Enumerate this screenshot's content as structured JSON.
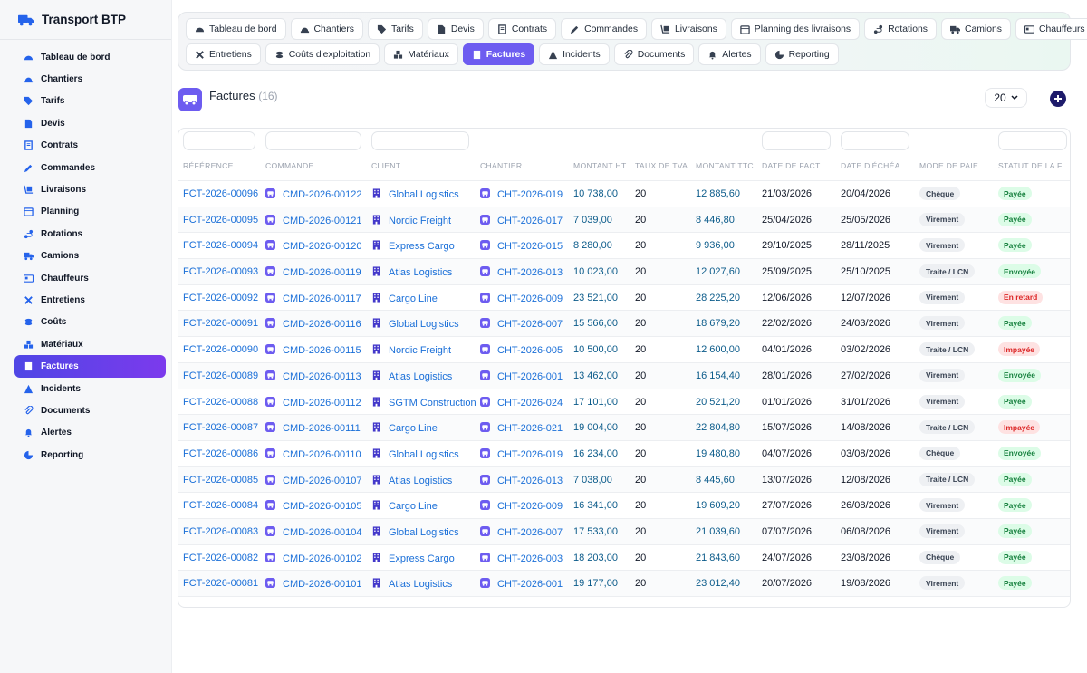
{
  "app": {
    "title": "Transport BTP"
  },
  "sidebar": {
    "items": [
      {
        "label": "Tableau de bord",
        "icon": "gauge-icon"
      },
      {
        "label": "Chantiers",
        "icon": "hardhat-icon"
      },
      {
        "label": "Tarifs",
        "icon": "tag-icon"
      },
      {
        "label": "Devis",
        "icon": "file-icon"
      },
      {
        "label": "Contrats",
        "icon": "contract-icon"
      },
      {
        "label": "Commandes",
        "icon": "edit-icon"
      },
      {
        "label": "Livraisons",
        "icon": "dolly-icon"
      },
      {
        "label": "Planning",
        "icon": "calendar-icon"
      },
      {
        "label": "Rotations",
        "icon": "route-icon"
      },
      {
        "label": "Camions",
        "icon": "truck-icon"
      },
      {
        "label": "Chauffeurs",
        "icon": "id-card-icon"
      },
      {
        "label": "Entretiens",
        "icon": "tools-icon"
      },
      {
        "label": "Coûts",
        "icon": "coins-icon"
      },
      {
        "label": "Matériaux",
        "icon": "cubes-icon"
      },
      {
        "label": "Factures",
        "icon": "invoice-icon",
        "active": true
      },
      {
        "label": "Incidents",
        "icon": "warning-icon"
      },
      {
        "label": "Documents",
        "icon": "paperclip-icon"
      },
      {
        "label": "Alertes",
        "icon": "bell-icon"
      },
      {
        "label": "Reporting",
        "icon": "pie-chart-icon"
      }
    ]
  },
  "tabs": {
    "row1": [
      {
        "label": "Tableau de bord",
        "icon": "gauge-icon"
      },
      {
        "label": "Chantiers",
        "icon": "hardhat-icon"
      },
      {
        "label": "Tarifs",
        "icon": "tag-icon"
      },
      {
        "label": "Devis",
        "icon": "file-icon"
      },
      {
        "label": "Contrats",
        "icon": "contract-icon"
      },
      {
        "label": "Commandes",
        "icon": "edit-icon"
      },
      {
        "label": "Livraisons",
        "icon": "dolly-icon"
      },
      {
        "label": "Planning des livraisons",
        "icon": "calendar-icon"
      },
      {
        "label": "Rotations",
        "icon": "route-icon"
      },
      {
        "label": "Camions",
        "icon": "truck-icon"
      },
      {
        "label": "Chauffeurs",
        "icon": "id-card-icon"
      }
    ],
    "row2": [
      {
        "label": "Entretiens",
        "icon": "tools-icon"
      },
      {
        "label": "Coûts d'exploitation",
        "icon": "coins-icon"
      },
      {
        "label": "Matériaux",
        "icon": "cubes-icon"
      },
      {
        "label": "Factures",
        "icon": "invoice-icon",
        "active": true
      },
      {
        "label": "Incidents",
        "icon": "warning-icon"
      },
      {
        "label": "Documents",
        "icon": "paperclip-icon"
      },
      {
        "label": "Alertes",
        "icon": "bell-icon"
      },
      {
        "label": "Reporting",
        "icon": "pie-chart-icon"
      }
    ]
  },
  "header": {
    "title": "Factures",
    "count": "(16)",
    "page_size": "20"
  },
  "table": {
    "columns": [
      "RÉFÉRENCE",
      "COMMANDE",
      "CLIENT",
      "CHANTIER",
      "MONTANT HT",
      "TAUX DE TVA",
      "MONTANT TTC",
      "DATE DE FACT...",
      "DATE D'ÉCHÉA...",
      "MODE DE PAIE...",
      "STATUT DE LA F..."
    ],
    "rows": [
      {
        "ref": "FCT-2026-00096",
        "cmd": "CMD-2026-00122",
        "client": "Global Logistics",
        "chantier": "CHT-2026-019",
        "ht": "10 738,00",
        "tva": "20",
        "ttc": "12 885,60",
        "date_fact": "21/03/2026",
        "date_ech": "20/04/2026",
        "mode": "Chèque",
        "statut": "Payée"
      },
      {
        "ref": "FCT-2026-00095",
        "cmd": "CMD-2026-00121",
        "client": "Nordic Freight",
        "chantier": "CHT-2026-017",
        "ht": "7 039,00",
        "tva": "20",
        "ttc": "8 446,80",
        "date_fact": "25/04/2026",
        "date_ech": "25/05/2026",
        "mode": "Virement",
        "statut": "Payée"
      },
      {
        "ref": "FCT-2026-00094",
        "cmd": "CMD-2026-00120",
        "client": "Express Cargo",
        "chantier": "CHT-2026-015",
        "ht": "8 280,00",
        "tva": "20",
        "ttc": "9 936,00",
        "date_fact": "29/10/2025",
        "date_ech": "28/11/2025",
        "mode": "Virement",
        "statut": "Payée"
      },
      {
        "ref": "FCT-2026-00093",
        "cmd": "CMD-2026-00119",
        "client": "Atlas Logistics",
        "chantier": "CHT-2026-013",
        "ht": "10 023,00",
        "tva": "20",
        "ttc": "12 027,60",
        "date_fact": "25/09/2025",
        "date_ech": "25/10/2025",
        "mode": "Traite / LCN",
        "statut": "Envoyée"
      },
      {
        "ref": "FCT-2026-00092",
        "cmd": "CMD-2026-00117",
        "client": "Cargo Line",
        "chantier": "CHT-2026-009",
        "ht": "23 521,00",
        "tva": "20",
        "ttc": "28 225,20",
        "date_fact": "12/06/2026",
        "date_ech": "12/07/2026",
        "mode": "Virement",
        "statut": "En retard"
      },
      {
        "ref": "FCT-2026-00091",
        "cmd": "CMD-2026-00116",
        "client": "Global Logistics",
        "chantier": "CHT-2026-007",
        "ht": "15 566,00",
        "tva": "20",
        "ttc": "18 679,20",
        "date_fact": "22/02/2026",
        "date_ech": "24/03/2026",
        "mode": "Virement",
        "statut": "Payée"
      },
      {
        "ref": "FCT-2026-00090",
        "cmd": "CMD-2026-00115",
        "client": "Nordic Freight",
        "chantier": "CHT-2026-005",
        "ht": "10 500,00",
        "tva": "20",
        "ttc": "12 600,00",
        "date_fact": "04/01/2026",
        "date_ech": "03/02/2026",
        "mode": "Traite / LCN",
        "statut": "Impayée"
      },
      {
        "ref": "FCT-2026-00089",
        "cmd": "CMD-2026-00113",
        "client": "Atlas Logistics",
        "chantier": "CHT-2026-001",
        "ht": "13 462,00",
        "tva": "20",
        "ttc": "16 154,40",
        "date_fact": "28/01/2026",
        "date_ech": "27/02/2026",
        "mode": "Virement",
        "statut": "Envoyée"
      },
      {
        "ref": "FCT-2026-00088",
        "cmd": "CMD-2026-00112",
        "client": "SGTM Construction",
        "chantier": "CHT-2026-024",
        "ht": "17 101,00",
        "tva": "20",
        "ttc": "20 521,20",
        "date_fact": "01/01/2026",
        "date_ech": "31/01/2026",
        "mode": "Virement",
        "statut": "Payée"
      },
      {
        "ref": "FCT-2026-00087",
        "cmd": "CMD-2026-00111",
        "client": "Cargo Line",
        "chantier": "CHT-2026-021",
        "ht": "19 004,00",
        "tva": "20",
        "ttc": "22 804,80",
        "date_fact": "15/07/2026",
        "date_ech": "14/08/2026",
        "mode": "Traite / LCN",
        "statut": "Impayée"
      },
      {
        "ref": "FCT-2026-00086",
        "cmd": "CMD-2026-00110",
        "client": "Global Logistics",
        "chantier": "CHT-2026-019",
        "ht": "16 234,00",
        "tva": "20",
        "ttc": "19 480,80",
        "date_fact": "04/07/2026",
        "date_ech": "03/08/2026",
        "mode": "Chèque",
        "statut": "Envoyée"
      },
      {
        "ref": "FCT-2026-00085",
        "cmd": "CMD-2026-00107",
        "client": "Atlas Logistics",
        "chantier": "CHT-2026-013",
        "ht": "7 038,00",
        "tva": "20",
        "ttc": "8 445,60",
        "date_fact": "13/07/2026",
        "date_ech": "12/08/2026",
        "mode": "Traite / LCN",
        "statut": "Payée"
      },
      {
        "ref": "FCT-2026-00084",
        "cmd": "CMD-2026-00105",
        "client": "Cargo Line",
        "chantier": "CHT-2026-009",
        "ht": "16 341,00",
        "tva": "20",
        "ttc": "19 609,20",
        "date_fact": "27/07/2026",
        "date_ech": "26/08/2026",
        "mode": "Virement",
        "statut": "Payée"
      },
      {
        "ref": "FCT-2026-00083",
        "cmd": "CMD-2026-00104",
        "client": "Global Logistics",
        "chantier": "CHT-2026-007",
        "ht": "17 533,00",
        "tva": "20",
        "ttc": "21 039,60",
        "date_fact": "07/07/2026",
        "date_ech": "06/08/2026",
        "mode": "Virement",
        "statut": "Payée"
      },
      {
        "ref": "FCT-2026-00082",
        "cmd": "CMD-2026-00102",
        "client": "Express Cargo",
        "chantier": "CHT-2026-003",
        "ht": "18 203,00",
        "tva": "20",
        "ttc": "21 843,60",
        "date_fact": "24/07/2026",
        "date_ech": "23/08/2026",
        "mode": "Chèque",
        "statut": "Payée"
      },
      {
        "ref": "FCT-2026-00081",
        "cmd": "CMD-2026-00101",
        "client": "Atlas Logistics",
        "chantier": "CHT-2026-001",
        "ht": "19 177,00",
        "tva": "20",
        "ttc": "23 012,40",
        "date_fact": "20/07/2026",
        "date_ech": "19/08/2026",
        "mode": "Virement",
        "statut": "Payée"
      }
    ]
  },
  "colors": {
    "accent": "#6d5cf0",
    "link": "#1a6fd8",
    "sidebar_icon": "#2563eb",
    "success": "#15803d",
    "danger": "#dc2626"
  }
}
